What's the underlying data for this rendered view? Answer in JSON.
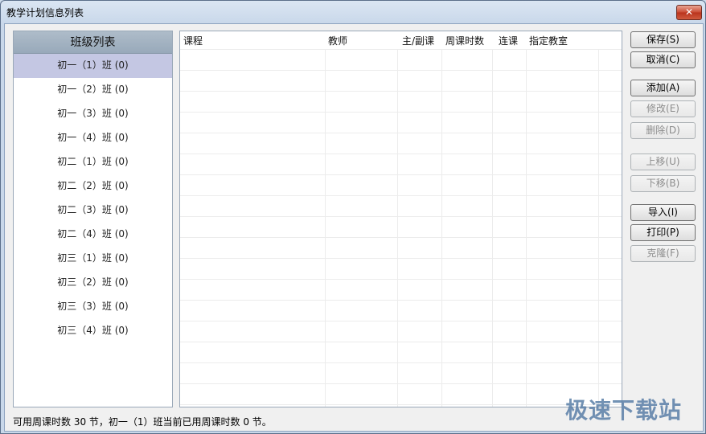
{
  "window": {
    "title": "教学计划信息列表",
    "close_glyph": "✕"
  },
  "class_list": {
    "header": "班级列表",
    "items": [
      "初一（1）班 (0)",
      "初一（2）班 (0)",
      "初一（3）班 (0)",
      "初一（4）班 (0)",
      "初二（1）班 (0)",
      "初二（2）班 (0)",
      "初二（3）班 (0)",
      "初二（4）班 (0)",
      "初三（1）班 (0)",
      "初三（2）班 (0)",
      "初三（3）班 (0)",
      "初三（4）班 (0)"
    ],
    "selected_index": 0
  },
  "grid": {
    "columns": [
      "课程",
      "教师",
      "主/副课",
      "周课时数",
      "连课",
      "指定教室"
    ]
  },
  "buttons": {
    "save": "保存(S)",
    "cancel": "取消(C)",
    "add": "添加(A)",
    "edit": "修改(E)",
    "delete": "删除(D)",
    "move_up": "上移(U)",
    "move_down": "下移(B)",
    "import": "导入(I)",
    "print": "打印(P)",
    "clone": "克隆(F)"
  },
  "status": "可用周课时数 30 节，初一（1）班当前已用周课时数 0 节。",
  "watermark": "极速下载站",
  "colors": {
    "selected_row": "#c4c7e3",
    "header_bg": "#a3b2c2"
  }
}
